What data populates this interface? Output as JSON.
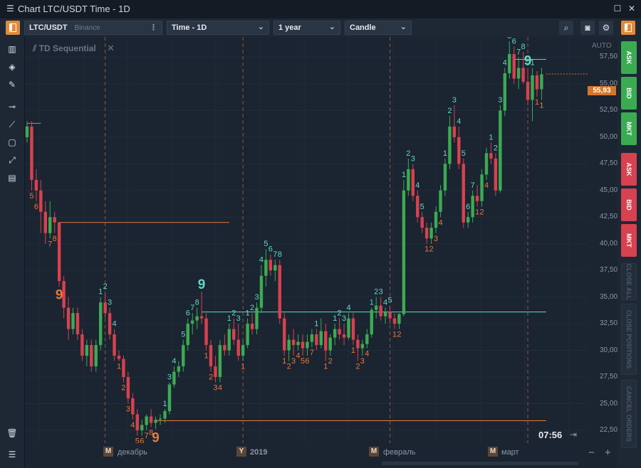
{
  "window": {
    "title": "Chart LTC/USDT Time - 1D"
  },
  "toolbar": {
    "symbol": "LTC/USDT",
    "exchange": "Binance",
    "timeframe": "Time - 1D",
    "range": "1 year",
    "chart_type": "Candle"
  },
  "indicator": {
    "name": "TD Sequential"
  },
  "price_axis": {
    "auto_label": "AUTO",
    "ticks": [
      "57,50",
      "55,00",
      "52,50",
      "50,00",
      "47,50",
      "45,00",
      "42,50",
      "40,00",
      "37,50",
      "35,00",
      "32,50",
      "30,00",
      "27,50",
      "25,00",
      "22,50"
    ],
    "current_price": "55,93"
  },
  "time_axis": {
    "markers": [
      {
        "badge": "M",
        "label": "декабрь"
      },
      {
        "badge": "Y",
        "label": "2019"
      },
      {
        "badge": "M",
        "label": "февраль"
      },
      {
        "badge": "M",
        "label": "март"
      }
    ],
    "clock": "07:56"
  },
  "right_panel": {
    "buttons": [
      {
        "label": "ASK",
        "color": "#3bab52"
      },
      {
        "label": "BID",
        "color": "#3bab52"
      },
      {
        "label": "MKT",
        "color": "#3bab52"
      },
      {
        "label": "ASK",
        "color": "#d8414f"
      },
      {
        "label": "BID",
        "color": "#d8414f"
      },
      {
        "label": "MKT",
        "color": "#d8414f"
      },
      {
        "label": "CLOSE ALL",
        "color": "#232e3b"
      },
      {
        "label": "CLOSE POSITIONS",
        "color": "#232e3b"
      },
      {
        "label": "CANCEL ORDERS",
        "color": "#232e3b"
      }
    ]
  },
  "colors": {
    "up": "#3bab52",
    "down": "#d8414f",
    "accent": "#e08a3c",
    "td_up": "#5fd9c2",
    "td_down": "#e8773a"
  },
  "chart_data": {
    "type": "candlestick",
    "y_range": [
      21.3,
      59.4
    ],
    "candles": [
      [
        50,
        51.5,
        49.5,
        51
      ],
      [
        51,
        51.5,
        45,
        46
      ],
      [
        46,
        47,
        44,
        45
      ],
      [
        45,
        46,
        41,
        43
      ],
      [
        43,
        44,
        40,
        41
      ],
      [
        41,
        44,
        40.5,
        42.5
      ],
      [
        42.5,
        43,
        41,
        42
      ],
      [
        42,
        42,
        36,
        36.5
      ],
      [
        36.5,
        37,
        33,
        34
      ],
      [
        34,
        35,
        31,
        32
      ],
      [
        32,
        34,
        31.5,
        33.5
      ],
      [
        33.5,
        34,
        31,
        31.5
      ],
      [
        31.5,
        32,
        29,
        29.5
      ],
      [
        29.5,
        31,
        28.5,
        30.5
      ],
      [
        30.5,
        31,
        28,
        28.5
      ],
      [
        28.5,
        31,
        28,
        30.5
      ],
      [
        30.5,
        35,
        30,
        34.5
      ],
      [
        34.5,
        35.5,
        33,
        33.5
      ],
      [
        33.5,
        34,
        31,
        31.5
      ],
      [
        31.5,
        32,
        29,
        29.5
      ],
      [
        29.5,
        30,
        29,
        29.2
      ],
      [
        29.2,
        29.5,
        27,
        27.5
      ],
      [
        27.5,
        28,
        25,
        25.5
      ],
      [
        25.5,
        26,
        23.5,
        24
      ],
      [
        24,
        24.5,
        22,
        22.5
      ],
      [
        22.5,
        23.5,
        22,
        23
      ],
      [
        23,
        24,
        22.5,
        23.8
      ],
      [
        23.8,
        24.5,
        22.8,
        23.2
      ],
      [
        23.2,
        23.8,
        22.6,
        23.5
      ],
      [
        23.5,
        24,
        23,
        23.6
      ],
      [
        23.6,
        24.5,
        23.2,
        24.3
      ],
      [
        24.3,
        27,
        24,
        26.8
      ],
      [
        26.8,
        28.5,
        26.5,
        28
      ],
      [
        28,
        29,
        27.5,
        28.5
      ],
      [
        28.5,
        31,
        28,
        30.5
      ],
      [
        30.5,
        33,
        30,
        32.5
      ],
      [
        32.5,
        33.5,
        31.5,
        32.8
      ],
      [
        32.8,
        34,
        32,
        33.2
      ],
      [
        33.2,
        35.5,
        32.5,
        33
      ],
      [
        33,
        33.5,
        30,
        30.5
      ],
      [
        30.5,
        31,
        28,
        28.5
      ],
      [
        28.5,
        29.5,
        27,
        27.5
      ],
      [
        27.5,
        31,
        27,
        30.5
      ],
      [
        30.5,
        31.5,
        29.5,
        30
      ],
      [
        30,
        32.5,
        29.5,
        32
      ],
      [
        32,
        33,
        30.5,
        31
      ],
      [
        31,
        32.5,
        29,
        29.5
      ],
      [
        29.5,
        31,
        29,
        30.5
      ],
      [
        30.5,
        33,
        30.2,
        32.5
      ],
      [
        32.5,
        33.5,
        31.5,
        32
      ],
      [
        32,
        34.5,
        31.5,
        34
      ],
      [
        34,
        38,
        33.5,
        37
      ],
      [
        37,
        39.5,
        36,
        38.5
      ],
      [
        38.5,
        39,
        37,
        37.5
      ],
      [
        37.5,
        38.5,
        36.5,
        38
      ],
      [
        38,
        38.5,
        32.5,
        33
      ],
      [
        33,
        33.5,
        29.5,
        30
      ],
      [
        30,
        31.5,
        29,
        31
      ],
      [
        31,
        32,
        29.5,
        30.5
      ],
      [
        30.5,
        31.5,
        30,
        30.8
      ],
      [
        30.8,
        31.5,
        29.5,
        30.2
      ],
      [
        30.2,
        31.5,
        29.5,
        30.8
      ],
      [
        30.8,
        32,
        30.3,
        31.5
      ],
      [
        31.5,
        32,
        30,
        30.5
      ],
      [
        30.5,
        33,
        30.2,
        31.8
      ],
      [
        31.8,
        32.5,
        29,
        30
      ],
      [
        30,
        31.5,
        29.5,
        31.2
      ],
      [
        31.2,
        32.5,
        30.5,
        32
      ],
      [
        32,
        33,
        31,
        31.5
      ],
      [
        31.5,
        32.5,
        30.5,
        31.2
      ],
      [
        31.2,
        33.5,
        31,
        33
      ],
      [
        33,
        33.5,
        30.5,
        31
      ],
      [
        31,
        31.5,
        29,
        30.2
      ],
      [
        30.2,
        31,
        29.5,
        30.6
      ],
      [
        30.6,
        32,
        30.2,
        31.5
      ],
      [
        31.5,
        34,
        31.2,
        33.8
      ],
      [
        33.8,
        35,
        33,
        34.2
      ],
      [
        34.2,
        35,
        32.8,
        33.2
      ],
      [
        33.2,
        34,
        32.5,
        33.6
      ],
      [
        33.6,
        34.2,
        32.5,
        33
      ],
      [
        33,
        33.5,
        32,
        32.5
      ],
      [
        32.5,
        33.5,
        32,
        33.4
      ],
      [
        33.4,
        46,
        33.2,
        45
      ],
      [
        45,
        48,
        44.5,
        47
      ],
      [
        47,
        47.5,
        44,
        44.5
      ],
      [
        44.5,
        45,
        42,
        42.5
      ],
      [
        42.5,
        43,
        41,
        41.5
      ],
      [
        41.5,
        42,
        40,
        40.5
      ],
      [
        40.5,
        42,
        40,
        41.5
      ],
      [
        41.5,
        43.5,
        41,
        43
      ],
      [
        43,
        45.5,
        42.5,
        45
      ],
      [
        45,
        48,
        44.5,
        47.5
      ],
      [
        47.5,
        52,
        47,
        51
      ],
      [
        51,
        53,
        49.5,
        50
      ],
      [
        50,
        51,
        47,
        47.5
      ],
      [
        47.5,
        48,
        41.5,
        42
      ],
      [
        42,
        43,
        41.5,
        42.5
      ],
      [
        42.5,
        45,
        42,
        44.5
      ],
      [
        44.5,
        45.5,
        43.5,
        44
      ],
      [
        44,
        47,
        43.5,
        46.5
      ],
      [
        46.5,
        49,
        46,
        48.5
      ],
      [
        48.5,
        49.5,
        47.5,
        48
      ],
      [
        48,
        48.5,
        44.5,
        45
      ],
      [
        45,
        53,
        44.8,
        52.5
      ],
      [
        52.5,
        56.5,
        52,
        56
      ],
      [
        56,
        59,
        55.5,
        57.8
      ],
      [
        57.8,
        58.5,
        55,
        55.5
      ],
      [
        55.5,
        57.5,
        54.5,
        56.5
      ],
      [
        56.5,
        58,
        55,
        55.2
      ],
      [
        55.2,
        56.5,
        53,
        53.5
      ],
      [
        53.5,
        56.5,
        51.5,
        55.8
      ],
      [
        55.8,
        56.2,
        53.8,
        54.5
      ],
      [
        54.5,
        56.5,
        53.5,
        55.9
      ]
    ],
    "td_labels": [
      {
        "i": 1,
        "n": "5",
        "side": "down"
      },
      {
        "i": 2,
        "n": "6",
        "side": "down"
      },
      {
        "i": 5,
        "n": "7",
        "side": "down"
      },
      {
        "i": 6,
        "n": "8",
        "side": "down"
      },
      {
        "i": 7,
        "n": "9",
        "side": "down",
        "big": true
      },
      {
        "i": 16,
        "n": "1",
        "side": "up"
      },
      {
        "i": 17,
        "n": "2",
        "side": "up"
      },
      {
        "i": 18,
        "n": "3",
        "side": "up"
      },
      {
        "i": 19,
        "n": "4",
        "side": "up"
      },
      {
        "i": 20,
        "n": "1",
        "side": "down"
      },
      {
        "i": 21,
        "n": "2",
        "side": "down"
      },
      {
        "i": 22,
        "n": "3",
        "side": "down"
      },
      {
        "i": 23,
        "n": "4",
        "side": "down"
      },
      {
        "i": 24,
        "n": "5",
        "side": "down"
      },
      {
        "i": 25,
        "n": "6",
        "side": "down"
      },
      {
        "i": 26,
        "n": "7",
        "side": "down"
      },
      {
        "i": 27,
        "n": "8",
        "side": "down"
      },
      {
        "i": 28,
        "n": "9",
        "side": "down",
        "big": true
      },
      {
        "i": 30,
        "n": "1",
        "side": "up"
      },
      {
        "i": 31,
        "n": "3",
        "side": "up"
      },
      {
        "i": 32,
        "n": "4",
        "side": "up"
      },
      {
        "i": 34,
        "n": "5",
        "side": "up"
      },
      {
        "i": 35,
        "n": "6",
        "side": "up"
      },
      {
        "i": 36,
        "n": "7",
        "side": "up"
      },
      {
        "i": 37,
        "n": "8",
        "side": "up"
      },
      {
        "i": 38,
        "n": "9",
        "side": "up",
        "big": true
      },
      {
        "i": 39,
        "n": "1",
        "side": "down"
      },
      {
        "i": 40,
        "n": "2",
        "side": "down"
      },
      {
        "i": 41,
        "n": "3",
        "side": "down"
      },
      {
        "i": 42,
        "n": "4",
        "side": "down"
      },
      {
        "i": 44,
        "n": "1",
        "side": "up"
      },
      {
        "i": 45,
        "n": "2",
        "side": "up"
      },
      {
        "i": 46,
        "n": "3",
        "side": "up"
      },
      {
        "i": 47,
        "n": "1",
        "side": "down"
      },
      {
        "i": 48,
        "n": "1",
        "side": "up"
      },
      {
        "i": 49,
        "n": "2",
        "side": "up"
      },
      {
        "i": 50,
        "n": "3",
        "side": "up"
      },
      {
        "i": 51,
        "n": "4",
        "side": "up"
      },
      {
        "i": 52,
        "n": "5",
        "side": "up"
      },
      {
        "i": 53,
        "n": "6",
        "side": "up"
      },
      {
        "i": 54,
        "n": "7",
        "side": "up"
      },
      {
        "i": 55,
        "n": "8",
        "side": "up"
      },
      {
        "i": 56,
        "n": "1",
        "side": "down"
      },
      {
        "i": 57,
        "n": "2",
        "side": "down"
      },
      {
        "i": 58,
        "n": "3",
        "side": "down"
      },
      {
        "i": 59,
        "n": "4",
        "side": "down"
      },
      {
        "i": 60,
        "n": "5",
        "side": "down"
      },
      {
        "i": 61,
        "n": "6",
        "side": "down"
      },
      {
        "i": 62,
        "n": "7",
        "side": "down"
      },
      {
        "i": 63,
        "n": "1",
        "side": "up"
      },
      {
        "i": 65,
        "n": "1",
        "side": "down"
      },
      {
        "i": 66,
        "n": "2",
        "side": "down"
      },
      {
        "i": 67,
        "n": "1",
        "side": "up"
      },
      {
        "i": 68,
        "n": "2",
        "side": "up"
      },
      {
        "i": 69,
        "n": "3",
        "side": "up"
      },
      {
        "i": 70,
        "n": "4",
        "side": "up"
      },
      {
        "i": 71,
        "n": "1",
        "side": "down"
      },
      {
        "i": 72,
        "n": "2",
        "side": "down"
      },
      {
        "i": 73,
        "n": "3",
        "side": "down"
      },
      {
        "i": 74,
        "n": "4",
        "side": "down"
      },
      {
        "i": 75,
        "n": "1",
        "side": "up"
      },
      {
        "i": 76,
        "n": "2",
        "side": "up"
      },
      {
        "i": 77,
        "n": "3",
        "side": "up"
      },
      {
        "i": 78,
        "n": "4",
        "side": "up"
      },
      {
        "i": 79,
        "n": "5",
        "side": "up"
      },
      {
        "i": 80,
        "n": "1",
        "side": "down"
      },
      {
        "i": 81,
        "n": "2",
        "side": "down"
      },
      {
        "i": 82,
        "n": "1",
        "side": "up"
      },
      {
        "i": 83,
        "n": "2",
        "side": "up"
      },
      {
        "i": 84,
        "n": "3",
        "side": "up"
      },
      {
        "i": 85,
        "n": "4",
        "side": "up"
      },
      {
        "i": 86,
        "n": "5",
        "side": "up"
      },
      {
        "i": 87,
        "n": "1",
        "side": "down"
      },
      {
        "i": 88,
        "n": "2",
        "side": "down"
      },
      {
        "i": 89,
        "n": "3",
        "side": "down"
      },
      {
        "i": 90,
        "n": "4",
        "side": "down"
      },
      {
        "i": 91,
        "n": "1",
        "side": "up"
      },
      {
        "i": 92,
        "n": "2",
        "side": "up"
      },
      {
        "i": 93,
        "n": "3",
        "side": "up"
      },
      {
        "i": 94,
        "n": "4",
        "side": "up"
      },
      {
        "i": 95,
        "n": "5",
        "side": "up"
      },
      {
        "i": 96,
        "n": "6",
        "side": "up"
      },
      {
        "i": 97,
        "n": "7",
        "side": "up"
      },
      {
        "i": 98,
        "n": "1",
        "side": "down"
      },
      {
        "i": 99,
        "n": "2",
        "side": "down"
      },
      {
        "i": 100,
        "n": "4",
        "side": "down"
      },
      {
        "i": 101,
        "n": "1",
        "side": "up"
      },
      {
        "i": 102,
        "n": "2",
        "side": "up"
      },
      {
        "i": 103,
        "n": "3",
        "side": "up"
      },
      {
        "i": 104,
        "n": "4",
        "side": "up"
      },
      {
        "i": 105,
        "n": "5",
        "side": "up"
      },
      {
        "i": 106,
        "n": "6",
        "side": "up"
      },
      {
        "i": 107,
        "n": "7",
        "side": "up"
      },
      {
        "i": 108,
        "n": "8",
        "side": "up"
      },
      {
        "i": 109,
        "n": "9",
        "side": "up",
        "big": true
      },
      {
        "i": 110,
        "n": "1",
        "side": "up"
      },
      {
        "i": 111,
        "n": "1",
        "side": "down"
      },
      {
        "i": 112,
        "n": "1",
        "side": "down"
      }
    ],
    "support_lines": [
      {
        "from": 0,
        "to": 3,
        "price": 51.3,
        "color": "#e8773a"
      },
      {
        "from": 7,
        "to": 44,
        "price": 42.0,
        "color": "#e8773a"
      },
      {
        "from": 28,
        "to": 113,
        "price": 23.4,
        "color": "#e8773a"
      },
      {
        "from": 38,
        "to": 113,
        "price": 33.6,
        "color": "#5fd9c2"
      },
      {
        "from": 106,
        "to": 113,
        "price": 57.3,
        "color": "#5fd9c2"
      }
    ],
    "month_dividers": [
      17,
      47,
      79,
      109
    ]
  }
}
